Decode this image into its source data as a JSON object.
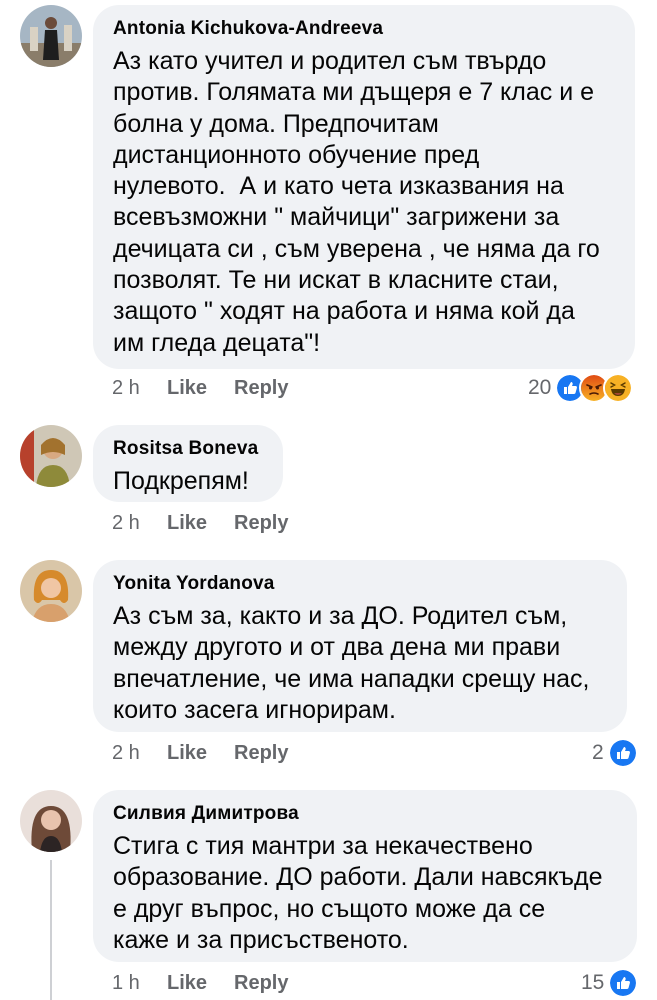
{
  "comments": [
    {
      "author": "Antonia Kichukova-Andreeva",
      "lines": [
        "Аз като учител и родител съм твърдо",
        "против. Голямата ми дъщеря е 7 клас и е",
        "болна у дома. Предпочитам",
        "дистанционното обучение пред",
        "нулевото.  А и като чета изказвания на",
        "всевъзможни \" майчици\" загрижени за",
        "дечицата си , съм уверена , че няма да го",
        "позволят. Те ни искат в класните стаи,",
        "защото \" ходят на работа и няма кой да",
        "им гледа децата\"!"
      ],
      "time": "2 h",
      "like": "Like",
      "reply": "Reply",
      "reaction_count": "20",
      "reactions": [
        "like-icon",
        "angry-icon",
        "haha-icon"
      ]
    },
    {
      "author": "Rositsa Boneva",
      "lines": [
        "Подкрепям!"
      ],
      "time": "2 h",
      "like": "Like",
      "reply": "Reply"
    },
    {
      "author": "Yonita Yordanova",
      "lines": [
        "Аз съм за, както и за ДО. Родител съм,",
        "между другото и от два дена ми прави",
        "впечатление, че има нападки срещу нас,",
        "които засега игнорирам."
      ],
      "time": "2 h",
      "like": "Like",
      "reply": "Reply",
      "reaction_count": "2",
      "reactions": [
        "like-icon"
      ]
    },
    {
      "author": "Силвия Димитрова",
      "lines": [
        "Стига с тия мантри за некачествено",
        "образование. ДО работи. Дали навсякъде",
        "е друг въпрос, но същото може да се",
        "каже и за присъственото."
      ],
      "time": "1 h",
      "like": "Like",
      "reply": "Reply",
      "reaction_count": "15",
      "reactions": [
        "like-icon"
      ]
    }
  ],
  "colors": {
    "bubble": "#f0f2f5",
    "meta_text": "#65676b",
    "like_blue": "#1877f2",
    "angry_orange": "#e9710f",
    "haha_yellow": "#f7b125"
  }
}
